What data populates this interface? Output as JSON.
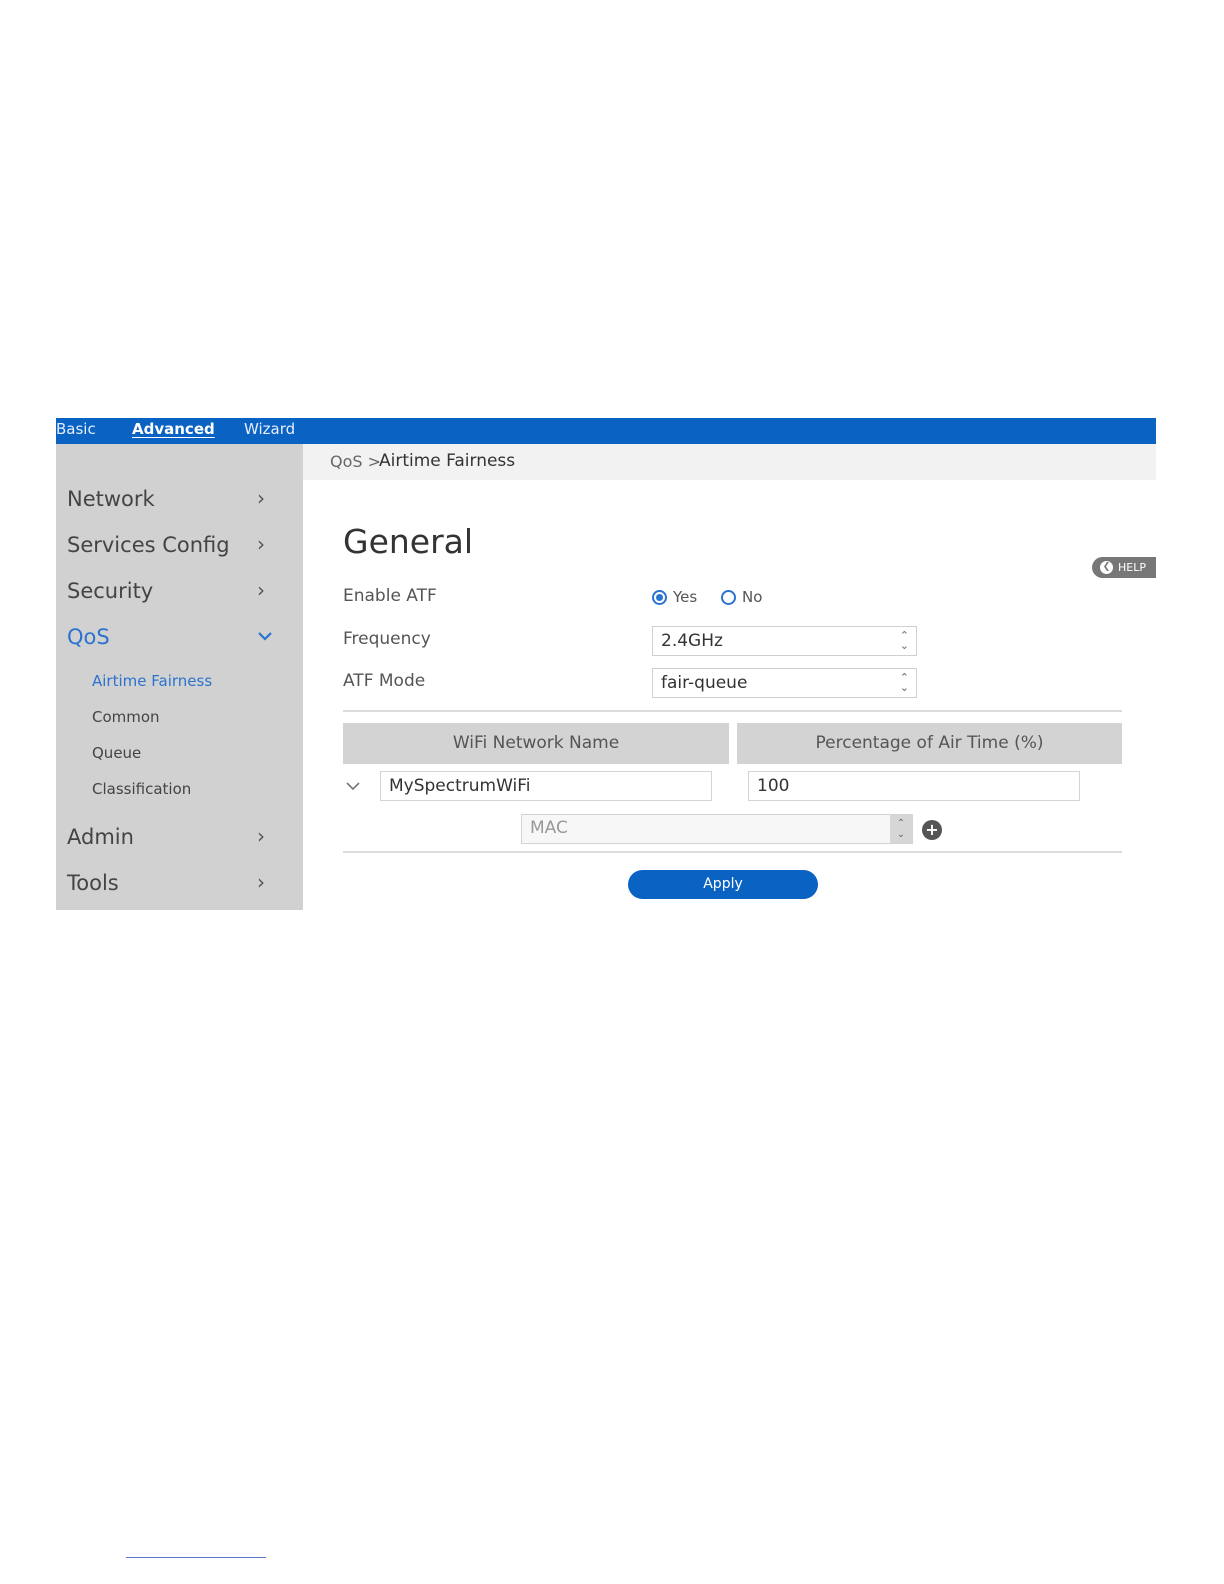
{
  "topnav": {
    "tabs": [
      "Basic",
      "Advanced",
      "Wizard"
    ],
    "active": "Advanced"
  },
  "sidebar": {
    "items": [
      {
        "label": "Network",
        "chevron": ">"
      },
      {
        "label": "Services Config",
        "chevron": ">"
      },
      {
        "label": "Security",
        "chevron": ">"
      },
      {
        "label": "QoS",
        "chevron": "v"
      },
      {
        "label": "Admin",
        "chevron": ">"
      },
      {
        "label": "Tools",
        "chevron": ">"
      }
    ],
    "qos_subitems": [
      "Airtime Fairness",
      "Common",
      "Queue",
      "Classification"
    ],
    "active_subitem": "Airtime Fairness"
  },
  "breadcrumb": {
    "parent": "QoS >",
    "current": "Airtime Fairness"
  },
  "page": {
    "title": "General",
    "help_label": "HELP"
  },
  "form": {
    "enable_atf": {
      "label": "Enable ATF",
      "yes": "Yes",
      "no": "No",
      "selected": "Yes"
    },
    "frequency": {
      "label": "Frequency",
      "value": "2.4GHz"
    },
    "atf_mode": {
      "label": "ATF Mode",
      "value": "fair-queue"
    }
  },
  "table": {
    "headers": [
      "WiFi Network Name",
      "Percentage of Air Time (%)"
    ],
    "rows": [
      {
        "network_name": "MySpectrumWiFi",
        "percentage": "100"
      }
    ],
    "mac_placeholder": "MAC"
  },
  "apply_label": "Apply",
  "colors": {
    "brand_blue": "#0a62c3",
    "link_blue": "#2b73cf",
    "sidebar_gray": "#d1d1d1"
  }
}
